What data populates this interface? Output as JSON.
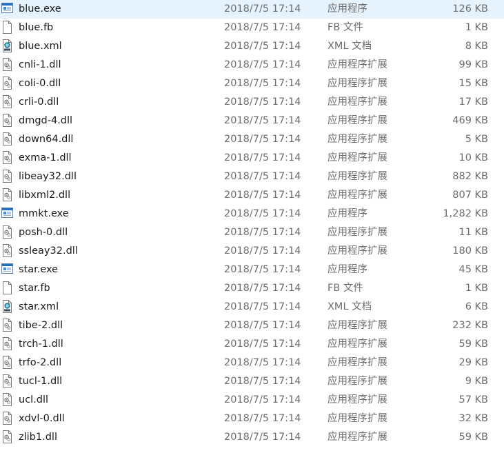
{
  "files": [
    {
      "name": "blue.exe",
      "date": "2018/7/5 17:14",
      "type": "应用程序",
      "size": "126 KB",
      "icon": "exe-icon"
    },
    {
      "name": "blue.fb",
      "date": "2018/7/5 17:14",
      "type": "FB 文件",
      "size": "1 KB",
      "icon": "blank-file-icon"
    },
    {
      "name": "blue.xml",
      "date": "2018/7/5 17:14",
      "type": "XML 文档",
      "size": "8 KB",
      "icon": "xml-icon"
    },
    {
      "name": "cnli-1.dll",
      "date": "2018/7/5 17:14",
      "type": "应用程序扩展",
      "size": "99 KB",
      "icon": "dll-icon"
    },
    {
      "name": "coli-0.dll",
      "date": "2018/7/5 17:14",
      "type": "应用程序扩展",
      "size": "15 KB",
      "icon": "dll-icon"
    },
    {
      "name": "crli-0.dll",
      "date": "2018/7/5 17:14",
      "type": "应用程序扩展",
      "size": "17 KB",
      "icon": "dll-icon"
    },
    {
      "name": "dmgd-4.dll",
      "date": "2018/7/5 17:14",
      "type": "应用程序扩展",
      "size": "469 KB",
      "icon": "dll-icon"
    },
    {
      "name": "down64.dll",
      "date": "2018/7/5 17:14",
      "type": "应用程序扩展",
      "size": "5 KB",
      "icon": "dll-icon"
    },
    {
      "name": "exma-1.dll",
      "date": "2018/7/5 17:14",
      "type": "应用程序扩展",
      "size": "10 KB",
      "icon": "dll-icon"
    },
    {
      "name": "libeay32.dll",
      "date": "2018/7/5 17:14",
      "type": "应用程序扩展",
      "size": "882 KB",
      "icon": "dll-icon"
    },
    {
      "name": "libxml2.dll",
      "date": "2018/7/5 17:14",
      "type": "应用程序扩展",
      "size": "807 KB",
      "icon": "dll-icon"
    },
    {
      "name": "mmkt.exe",
      "date": "2018/7/5 17:14",
      "type": "应用程序",
      "size": "1,282 KB",
      "icon": "exe-icon"
    },
    {
      "name": "posh-0.dll",
      "date": "2018/7/5 17:14",
      "type": "应用程序扩展",
      "size": "11 KB",
      "icon": "dll-icon"
    },
    {
      "name": "ssleay32.dll",
      "date": "2018/7/5 17:14",
      "type": "应用程序扩展",
      "size": "180 KB",
      "icon": "dll-icon"
    },
    {
      "name": "star.exe",
      "date": "2018/7/5 17:14",
      "type": "应用程序",
      "size": "45 KB",
      "icon": "exe-icon"
    },
    {
      "name": "star.fb",
      "date": "2018/7/5 17:14",
      "type": "FB 文件",
      "size": "1 KB",
      "icon": "blank-file-icon"
    },
    {
      "name": "star.xml",
      "date": "2018/7/5 17:14",
      "type": "XML 文档",
      "size": "6 KB",
      "icon": "xml-icon"
    },
    {
      "name": "tibe-2.dll",
      "date": "2018/7/5 17:14",
      "type": "应用程序扩展",
      "size": "232 KB",
      "icon": "dll-icon"
    },
    {
      "name": "trch-1.dll",
      "date": "2018/7/5 17:14",
      "type": "应用程序扩展",
      "size": "59 KB",
      "icon": "dll-icon"
    },
    {
      "name": "trfo-2.dll",
      "date": "2018/7/5 17:14",
      "type": "应用程序扩展",
      "size": "29 KB",
      "icon": "dll-icon"
    },
    {
      "name": "tucl-1.dll",
      "date": "2018/7/5 17:14",
      "type": "应用程序扩展",
      "size": "9 KB",
      "icon": "dll-icon"
    },
    {
      "name": "ucl.dll",
      "date": "2018/7/5 17:14",
      "type": "应用程序扩展",
      "size": "57 KB",
      "icon": "dll-icon"
    },
    {
      "name": "xdvl-0.dll",
      "date": "2018/7/5 17:14",
      "type": "应用程序扩展",
      "size": "32 KB",
      "icon": "dll-icon"
    },
    {
      "name": "zlib1.dll",
      "date": "2018/7/5 17:14",
      "type": "应用程序扩展",
      "size": "59 KB",
      "icon": "dll-icon"
    }
  ],
  "colors": {
    "name_text": "#1a1a1a",
    "detail_text": "#6d6d6d",
    "exe_blue": "#1f6fc5",
    "xml_teal": "#2a7f96",
    "hover_bg": "#e5f3ff"
  }
}
